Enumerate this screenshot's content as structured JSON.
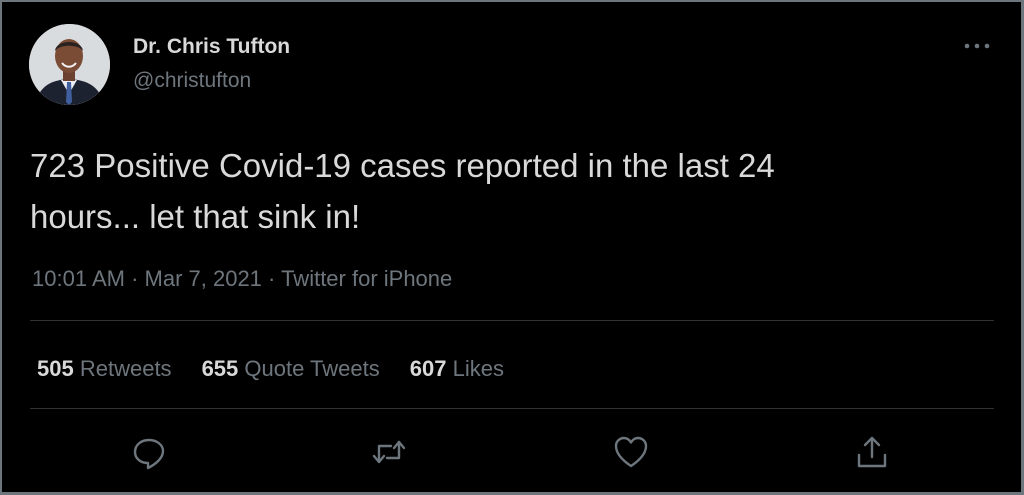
{
  "author": {
    "name": "Dr. Chris Tufton",
    "handle": "@christufton",
    "avatar_icon": "profile-photo"
  },
  "tweet": {
    "text_line1": "723 Positive Covid-19 cases reported in the last 24",
    "text_line2": "hours... let that sink in!",
    "time": "10:01 AM",
    "date": "Mar 7, 2021",
    "source": "Twitter for iPhone",
    "separator": " · "
  },
  "stats": {
    "retweets_count": "505",
    "retweets_label": "Retweets",
    "quote_count": "655",
    "quote_label": "Quote Tweets",
    "likes_count": "607",
    "likes_label": "Likes"
  },
  "actions": {
    "reply_icon": "reply-icon",
    "retweet_icon": "retweet-icon",
    "like_icon": "heart-icon",
    "share_icon": "share-icon"
  },
  "colors": {
    "background": "#000000",
    "text_primary": "#d9d9d9",
    "text_secondary": "#6e767d",
    "divider": "#2f3336"
  }
}
